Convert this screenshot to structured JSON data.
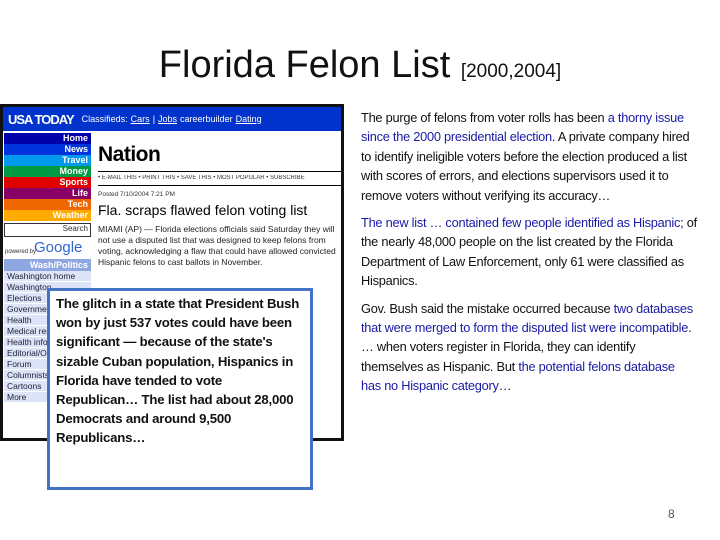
{
  "slide": {
    "title": "Florida Felon List",
    "title_suffix": "[2000,2004]",
    "page_number": "8"
  },
  "screenshot": {
    "logo": "USA TODAY",
    "topbar": {
      "classifieds": "Classifieds:",
      "cars": "Cars",
      "jobs": "Jobs",
      "careerbuilder": "careerbuilder",
      "dating": "Dating"
    },
    "nav": [
      {
        "label": "Home",
        "color": "#0000a8"
      },
      {
        "label": "News",
        "color": "#0033dd"
      },
      {
        "label": "Travel",
        "color": "#0099ee"
      },
      {
        "label": "Money",
        "color": "#009944"
      },
      {
        "label": "Sports",
        "color": "#e00000"
      },
      {
        "label": "Life",
        "color": "#880066"
      },
      {
        "label": "Tech",
        "color": "#ee6600"
      },
      {
        "label": "Weather",
        "color": "#ffaa00"
      }
    ],
    "search_label": "Search",
    "powered_by": "powered by",
    "google": "Google",
    "section": "Wash/Politics",
    "links": [
      "Washington home",
      "Washington",
      "Elections",
      "Government",
      "Health",
      "Medical resources",
      "Health info",
      "Editorial/Opinion",
      "Forum",
      "Columnists",
      "Cartoons",
      "More"
    ],
    "section_title": "Nation",
    "tools": "• E-MAIL THIS • PRINT THIS • SAVE THIS • MOST POPULAR • SUBSCRIBE",
    "posted": "Posted 7/10/2004 7:21 PM",
    "headline": "Fla. scraps flawed felon voting list",
    "body": "MIAMI (AP) — Florida elections officials said Saturday they will not use a disputed list that was designed to keep felons from voting, acknowledging a flaw that could have allowed convicted Hispanic felons to cast ballots in November."
  },
  "callout": "The glitch in a state that President Bush won by just 537 votes could have been significant — because of the state's sizable Cuban population, Hispanics in Florida have tended to vote Republican… The list had about 28,000 Democrats and around 9,500 Republicans…",
  "paragraphs": [
    [
      {
        "t": "The purge of felons from voter rolls has been ",
        "h": false
      },
      {
        "t": "a thorny issue since the 2000 presidential election",
        "h": true
      },
      {
        "t": ". A private company hired to identify ineligible voters before the election produced a list with scores of errors, and elections supervisors used it to remove voters without verifying its accuracy…",
        "h": false
      }
    ],
    [
      {
        "t": "The new list … contained few people identified as Hispanic",
        "h": true
      },
      {
        "t": "; of the nearly 48,000 people on the list created by the Florida Department of Law Enforcement, only 61 were classified as Hispanics.",
        "h": false
      }
    ],
    [
      {
        "t": "Gov. Bush said the mistake occurred because ",
        "h": false
      },
      {
        "t": "two databases that were merged to form the disputed list were incompatible",
        "h": true
      },
      {
        "t": ". … when voters register in Florida, they can identify themselves as Hispanic. But ",
        "h": false
      },
      {
        "t": "the potential felons database has no Hispanic category",
        "h": true
      },
      {
        "t": "…",
        "h": false
      }
    ]
  ],
  "colors": {
    "highlight": "#1a1aa6",
    "callout_border": "#4472c4",
    "usatoday_blue": "#0033cc"
  }
}
